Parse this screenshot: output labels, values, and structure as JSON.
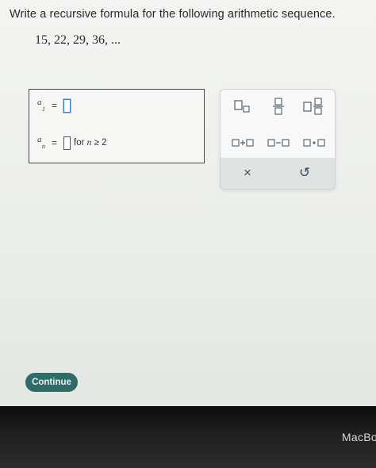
{
  "question": {
    "instruction": "Write a recursive formula for the following arithmetic sequence.",
    "sequence": "15, 22, 29, 36, ..."
  },
  "answer": {
    "row1": {
      "variable": "a",
      "subscript": "1",
      "equals": "="
    },
    "row2": {
      "variable": "a",
      "subscript": "n",
      "equals": "=",
      "condition_for": "for",
      "condition_n": "n",
      "condition_rest": "≥ 2"
    }
  },
  "palette": {
    "buttons": [
      "subscript-icon",
      "fraction-icon",
      "mixed-number-icon",
      "addition-icon",
      "subtraction-icon",
      "multiplication-icon"
    ],
    "clear_label": "×",
    "undo_label": "↺"
  },
  "actions": {
    "continue_label": "Continue"
  },
  "device": {
    "brand_text": "MacBo"
  },
  "colors": {
    "accent": "#2f6b67",
    "focus": "#2e7dd1"
  }
}
